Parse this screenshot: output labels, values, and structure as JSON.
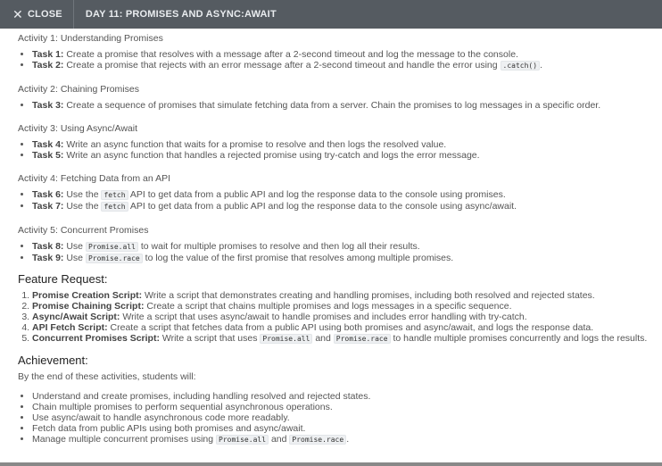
{
  "header": {
    "close_label": "CLOSE",
    "title": "DAY 11: PROMISES AND ASYNC:AWAIT"
  },
  "activities": [
    {
      "title": "Activity 1: Understanding Promises",
      "tasks": [
        {
          "label": "Task 1:",
          "text": "Create a promise that resolves with a message after a 2-second timeout and log the message to the console.",
          "code": "",
          "after": ""
        },
        {
          "label": "Task 2:",
          "text": "Create a promise that rejects with an error message after a 2-second timeout and handle the error using",
          "code": ".catch()",
          "after": "."
        }
      ]
    },
    {
      "title": "Activity 2: Chaining Promises",
      "tasks": [
        {
          "label": "Task 3:",
          "text": "Create a sequence of promises that simulate fetching data from a server. Chain the promises to log messages in a specific order.",
          "code": "",
          "after": ""
        }
      ]
    },
    {
      "title": "Activity 3: Using Async/Await",
      "tasks": [
        {
          "label": "Task 4:",
          "text": "Write an async function that waits for a promise to resolve and then logs the resolved value.",
          "code": "",
          "after": ""
        },
        {
          "label": "Task 5:",
          "text": "Write an async function that handles a rejected promise using try-catch and logs the error message.",
          "code": "",
          "after": ""
        }
      ]
    },
    {
      "title": "Activity 4: Fetching Data from an API",
      "tasks": [
        {
          "label": "Task 6:",
          "before": "Use the",
          "code": "fetch",
          "after": "API to get data from a public API and log the response data to the console using promises."
        },
        {
          "label": "Task 7:",
          "before": "Use the",
          "code": "fetch",
          "after": "API to get data from a public API and log the response data to the console using async/await."
        }
      ]
    },
    {
      "title": "Activity 5: Concurrent Promises",
      "tasks": [
        {
          "label": "Task 8:",
          "before": "Use",
          "code": "Promise.all",
          "after": "to wait for multiple promises to resolve and then log all their results."
        },
        {
          "label": "Task 9:",
          "before": "Use",
          "code": "Promise.race",
          "after": "to log the value of the first promise that resolves among multiple promises."
        }
      ]
    }
  ],
  "feature_request": {
    "heading": "Feature Request:",
    "items": [
      {
        "label": "Promise Creation Script:",
        "text": "Write a script that demonstrates creating and handling promises, including both resolved and rejected states."
      },
      {
        "label": "Promise Chaining Script:",
        "text": "Create a script that chains multiple promises and logs messages in a specific sequence."
      },
      {
        "label": "Async/Await Script:",
        "text": "Write a script that uses async/await to handle promises and includes error handling with try-catch."
      },
      {
        "label": "API Fetch Script:",
        "text": "Create a script that fetches data from a public API using both promises and async/await, and logs the response data."
      },
      {
        "label": "Concurrent Promises Script:",
        "text": "Write a script that uses",
        "code1": "Promise.all",
        "mid": "and",
        "code2": "Promise.race",
        "after": "to handle multiple promises concurrently and logs the results."
      }
    ]
  },
  "achievement": {
    "heading": "Achievement:",
    "intro": "By the end of these activities, students will:",
    "items": [
      "Understand and create promises, including handling resolved and rejected states.",
      "Chain multiple promises to perform sequential asynchronous operations.",
      "Use async/await to handle asynchronous code more readably.",
      "Fetch data from public APIs using both promises and async/await."
    ],
    "last_item": {
      "before": "Manage multiple concurrent promises using",
      "code1": "Promise.all",
      "mid": "and",
      "code2": "Promise.race",
      "after": "."
    }
  }
}
